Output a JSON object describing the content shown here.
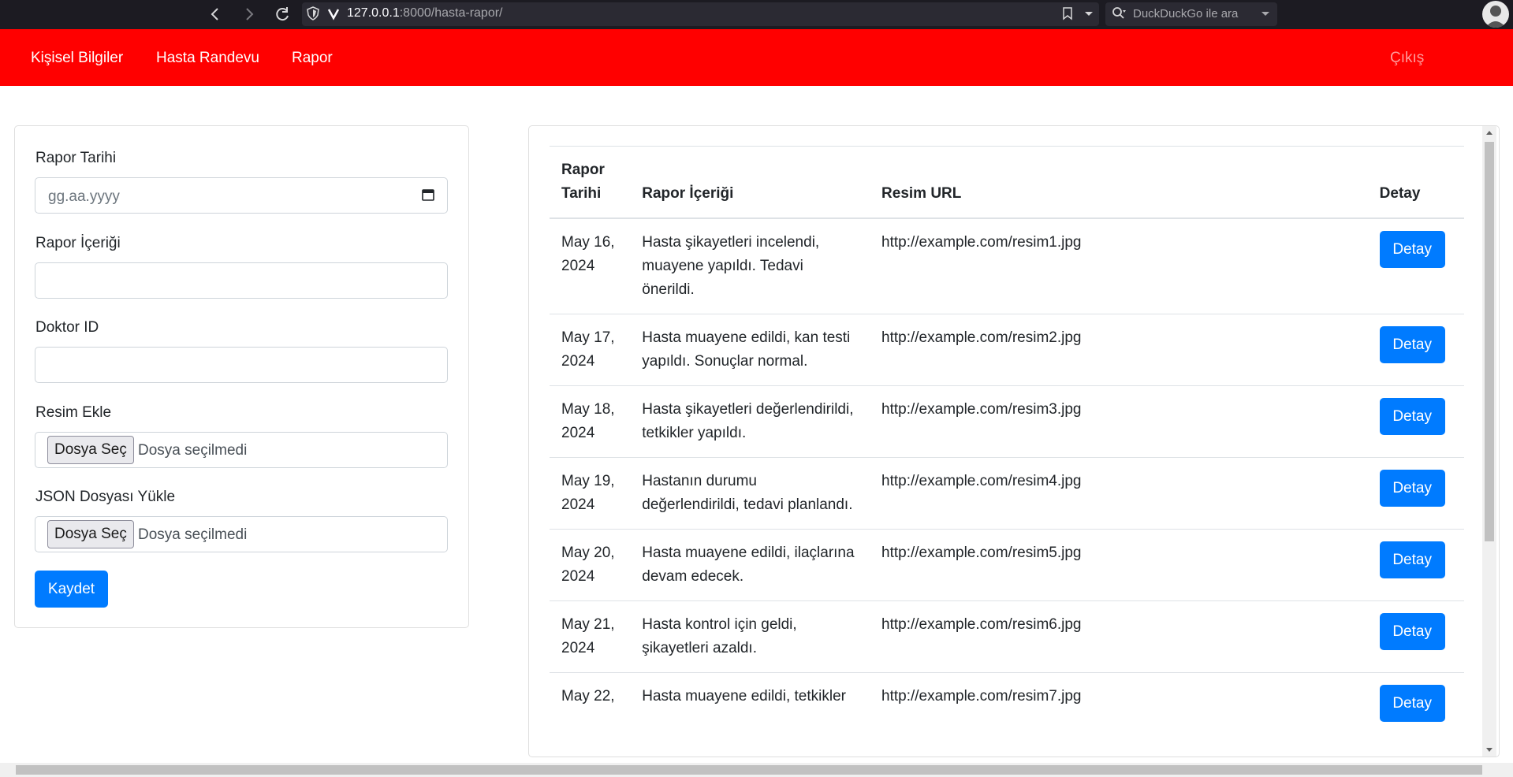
{
  "browser": {
    "url_host": "127.0.0.1",
    "url_rest": ":8000/hasta-rapor/",
    "search_placeholder": "DuckDuckGo ile ara",
    "back_icon": "arrow-left-icon",
    "forward_icon": "arrow-right-icon",
    "reload_icon": "reload-icon"
  },
  "navbar": {
    "items": [
      "Kişisel Bilgiler",
      "Hasta Randevu",
      "Rapor"
    ],
    "logout": "Çıkış",
    "bg_color": "#ff0000"
  },
  "form": {
    "date_label": "Rapor Tarihi",
    "date_placeholder": "gg.aa.yyyy",
    "content_label": "Rapor İçeriği",
    "content_value": "",
    "doctor_label": "Doktor ID",
    "doctor_value": "",
    "image_label": "Resim Ekle",
    "json_label": "JSON Dosyası Yükle",
    "file_button": "Dosya Seç",
    "file_status": "Dosya seçilmedi",
    "save_button": "Kaydet",
    "button_color": "#007bff"
  },
  "table": {
    "headers": [
      "Rapor Tarihi",
      "Rapor İçeriği",
      "Resim URL",
      "Detay"
    ],
    "rows": [
      {
        "date": "May 16, 2024",
        "content": "Hasta şikayetleri incelendi, muayene yapıldı. Tedavi önerildi.",
        "url": "http://example.com/resim1.jpg",
        "action": "Detay"
      },
      {
        "date": "May 17, 2024",
        "content": "Hasta muayene edildi, kan testi yapıldı. Sonuçlar normal.",
        "url": "http://example.com/resim2.jpg",
        "action": "Detay"
      },
      {
        "date": "May 18, 2024",
        "content": "Hasta şikayetleri değerlendirildi, tetkikler yapıldı.",
        "url": "http://example.com/resim3.jpg",
        "action": "Detay"
      },
      {
        "date": "May 19, 2024",
        "content": "Hastanın durumu değerlendirildi, tedavi planlandı.",
        "url": "http://example.com/resim4.jpg",
        "action": "Detay"
      },
      {
        "date": "May 20, 2024",
        "content": "Hasta muayene edildi, ilaçlarına devam edecek.",
        "url": "http://example.com/resim5.jpg",
        "action": "Detay"
      },
      {
        "date": "May 21, 2024",
        "content": "Hasta kontrol için geldi, şikayetleri azaldı.",
        "url": "http://example.com/resim6.jpg",
        "action": "Detay"
      },
      {
        "date": "May 22,",
        "content": "Hasta muayene edildi, tetkikler",
        "url": "http://example.com/resim7.jpg",
        "action": "Detay"
      }
    ]
  }
}
